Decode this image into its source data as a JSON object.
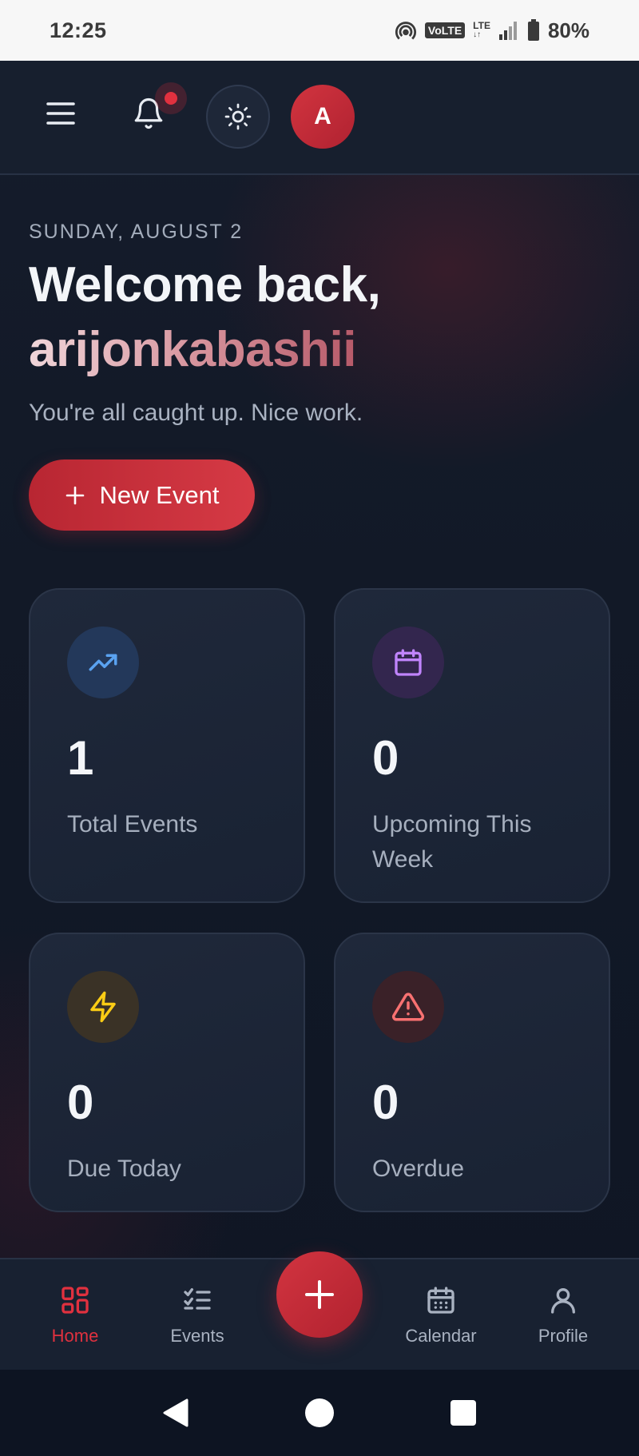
{
  "status_bar": {
    "time": "12:25",
    "volte": "VoLTE",
    "lte": "LTE",
    "battery": "80%"
  },
  "header": {
    "avatar_initial": "A",
    "notification_badge": true
  },
  "hero": {
    "date": "SUNDAY, AUGUST 2",
    "welcome": "Welcome back,",
    "username": "arijonkabashii",
    "subtitle": "You're all caught up. Nice work.",
    "new_event_label": "New Event"
  },
  "stats": [
    {
      "value": "1",
      "label": "Total Events",
      "icon": "trending-up-icon",
      "color": "#5aa2f0"
    },
    {
      "value": "0",
      "label": "Upcoming This Week",
      "icon": "calendar-icon",
      "color": "#c084fc"
    },
    {
      "value": "0",
      "label": "Due Today",
      "icon": "lightning-icon",
      "color": "#facc15"
    },
    {
      "value": "0",
      "label": "Overdue",
      "icon": "warning-icon",
      "color": "#f87171"
    }
  ],
  "bottom_nav": {
    "items": [
      {
        "label": "Home",
        "icon": "grid-icon",
        "active": true
      },
      {
        "label": "Events",
        "icon": "checklist-icon",
        "active": false
      },
      {
        "label": "Calendar",
        "icon": "calendar-icon",
        "active": false
      },
      {
        "label": "Profile",
        "icon": "user-icon",
        "active": false
      }
    ]
  },
  "colors": {
    "accent": "#d23440",
    "background": "#0f1624",
    "card": "#1d2637"
  }
}
